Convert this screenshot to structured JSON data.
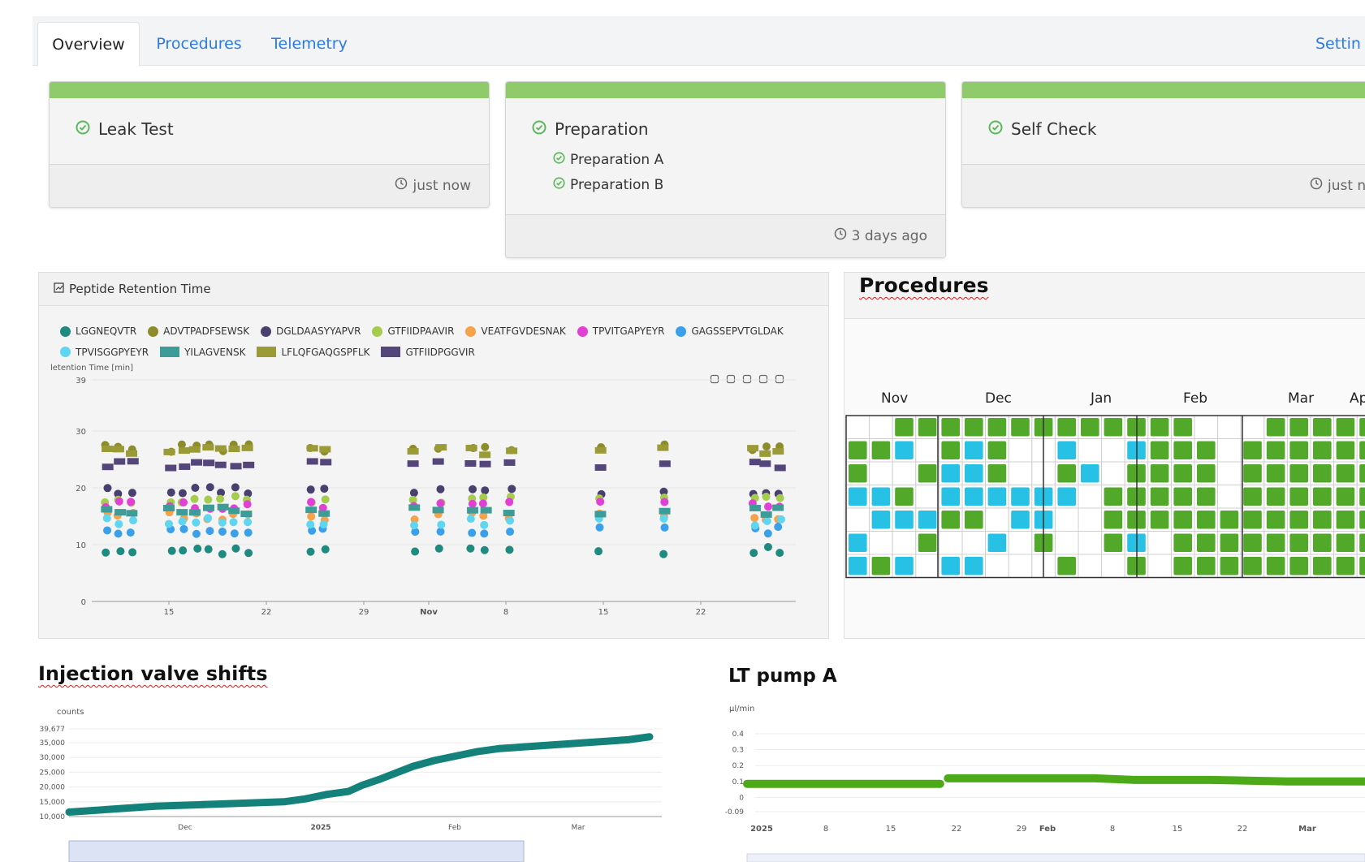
{
  "tabs": [
    {
      "label": "Overview",
      "active": true
    },
    {
      "label": "Procedures",
      "active": false
    },
    {
      "label": "Telemetry",
      "active": false
    }
  ],
  "settings_label": "Settin",
  "status_color": "#8fcb6b",
  "status_cards": [
    {
      "title": "Leak Test",
      "subitems": [],
      "time": "just now"
    },
    {
      "title": "Preparation",
      "subitems": [
        "Preparation A",
        "Preparation B"
      ],
      "time": "3 days ago"
    },
    {
      "title": "Self Check",
      "subitems": [],
      "time": "just n"
    }
  ],
  "retention_panel": {
    "header": "Peptide Retention Time",
    "legend": [
      {
        "name": "LGGNEQVTR",
        "color": "#1f8a80",
        "shape": "circle"
      },
      {
        "name": "ADVTPADFSEWSK",
        "color": "#8c8c2a",
        "shape": "circle"
      },
      {
        "name": "DGLDAASYYAPVR",
        "color": "#4a4070",
        "shape": "circle"
      },
      {
        "name": "GTFIIDPAAVIR",
        "color": "#a5cc4c",
        "shape": "circle"
      },
      {
        "name": "VEATFGVDESNAK",
        "color": "#f5a24a",
        "shape": "circle"
      },
      {
        "name": "TPVITGAPYEYR",
        "color": "#e23fd4",
        "shape": "circle"
      },
      {
        "name": "GAGSSEPVTGLDAK",
        "color": "#3aa0ea",
        "shape": "circle"
      },
      {
        "name": "TPVISGGPYEYR",
        "color": "#5fd5f0",
        "shape": "circle"
      },
      {
        "name": "YILAGVENSK",
        "color": "#3e9c98",
        "shape": "rect"
      },
      {
        "name": "LFLQFGAQGSPFLK",
        "color": "#9a9a36",
        "shape": "rect"
      },
      {
        "name": "GTFIIDPGGVIR",
        "color": "#54467a",
        "shape": "rect"
      }
    ],
    "toolbar_icons": [
      "zoom-icon",
      "zoom-reset-icon",
      "refresh-icon",
      "download-icon",
      "data-view-icon"
    ]
  },
  "procedures_panel": {
    "title": "Procedures",
    "months": [
      "Nov",
      "Dec",
      "Jan",
      "Feb",
      "Mar",
      "Ap"
    ],
    "colors": {
      "done": "#52a828",
      "scheduled": "#27c1e6",
      "warning": "#f2b41c",
      "empty": "#ffffff"
    }
  },
  "valve_chart": {
    "title": "Injection valve shifts"
  },
  "pump_chart": {
    "title": "LT pump A"
  },
  "chart_data": [
    {
      "type": "scatter",
      "title": "",
      "ylabel": "letention Time [min]",
      "ylim": [
        0,
        39
      ],
      "yticks": [
        0,
        10,
        20,
        30,
        39
      ],
      "xticks": [
        "15",
        "22",
        "29",
        "Nov",
        "8",
        "15",
        "22"
      ],
      "series": [
        {
          "name": "LGGNEQVTR",
          "baseline": 9
        },
        {
          "name": "ADVTPADFSEWSK",
          "baseline": 27
        },
        {
          "name": "DGLDAASYYAPVR",
          "baseline": 19.5
        },
        {
          "name": "GTFIIDPAAVIR",
          "baseline": 18
        },
        {
          "name": "VEATFGVDESNAK",
          "baseline": 15
        },
        {
          "name": "TPVITGAPYEYR",
          "baseline": 17
        },
        {
          "name": "GAGSSEPVTGLDAK",
          "baseline": 12.5
        },
        {
          "name": "TPVISGGPYEYR",
          "baseline": 14
        },
        {
          "name": "YILAGVENSK",
          "baseline": 16
        },
        {
          "name": "LFLQFGAQGSPFLK",
          "baseline": 26.5
        },
        {
          "name": "GTFIIDPGGVIR",
          "baseline": 24
        }
      ],
      "run_days": [
        8.5,
        9.5,
        10.5,
        13.5,
        14.5,
        15.5,
        16.5,
        17.5,
        18.5,
        19.5,
        24.5,
        25.5,
        32.5,
        34.5,
        37,
        38,
        40,
        47,
        52,
        59,
        60,
        61
      ]
    },
    {
      "type": "line",
      "ylabel": "counts",
      "yticks": [
        "10,000",
        "15,000",
        "20,000",
        "25,000",
        "30,000",
        "35,000",
        "39,677"
      ],
      "xticks": [
        "Dec",
        "2025",
        "Feb",
        "Mar"
      ],
      "points": [
        [
          0,
          11500
        ],
        [
          10,
          12500
        ],
        [
          20,
          13500
        ],
        [
          30,
          14000
        ],
        [
          40,
          14500
        ],
        [
          50,
          15000
        ],
        [
          55,
          16000
        ],
        [
          60,
          17500
        ],
        [
          65,
          18500
        ],
        [
          68,
          20500
        ],
        [
          72,
          22500
        ],
        [
          80,
          27000
        ],
        [
          85,
          29000
        ],
        [
          90,
          30500
        ],
        [
          95,
          32000
        ],
        [
          100,
          33000
        ],
        [
          110,
          34000
        ],
        [
          120,
          35000
        ],
        [
          130,
          36000
        ],
        [
          135,
          37000
        ]
      ]
    },
    {
      "type": "line",
      "ylabel": "µl/min",
      "yticks": [
        "-0.09",
        "0",
        "0.1",
        "0.2",
        "0.3",
        "0.4"
      ],
      "xticks": [
        "2025",
        "8",
        "15",
        "22",
        "29",
        "Feb",
        "8",
        "15",
        "22",
        "Mar"
      ],
      "points": [
        [
          0,
          0.085
        ],
        [
          10,
          0.085
        ],
        [
          20,
          0.085
        ],
        [
          25,
          0.085
        ],
        [
          26,
          0.12
        ],
        [
          40,
          0.12
        ],
        [
          45,
          0.12
        ],
        [
          50,
          0.11
        ],
        [
          60,
          0.11
        ],
        [
          70,
          0.1
        ],
        [
          80,
          0.1
        ]
      ]
    }
  ]
}
